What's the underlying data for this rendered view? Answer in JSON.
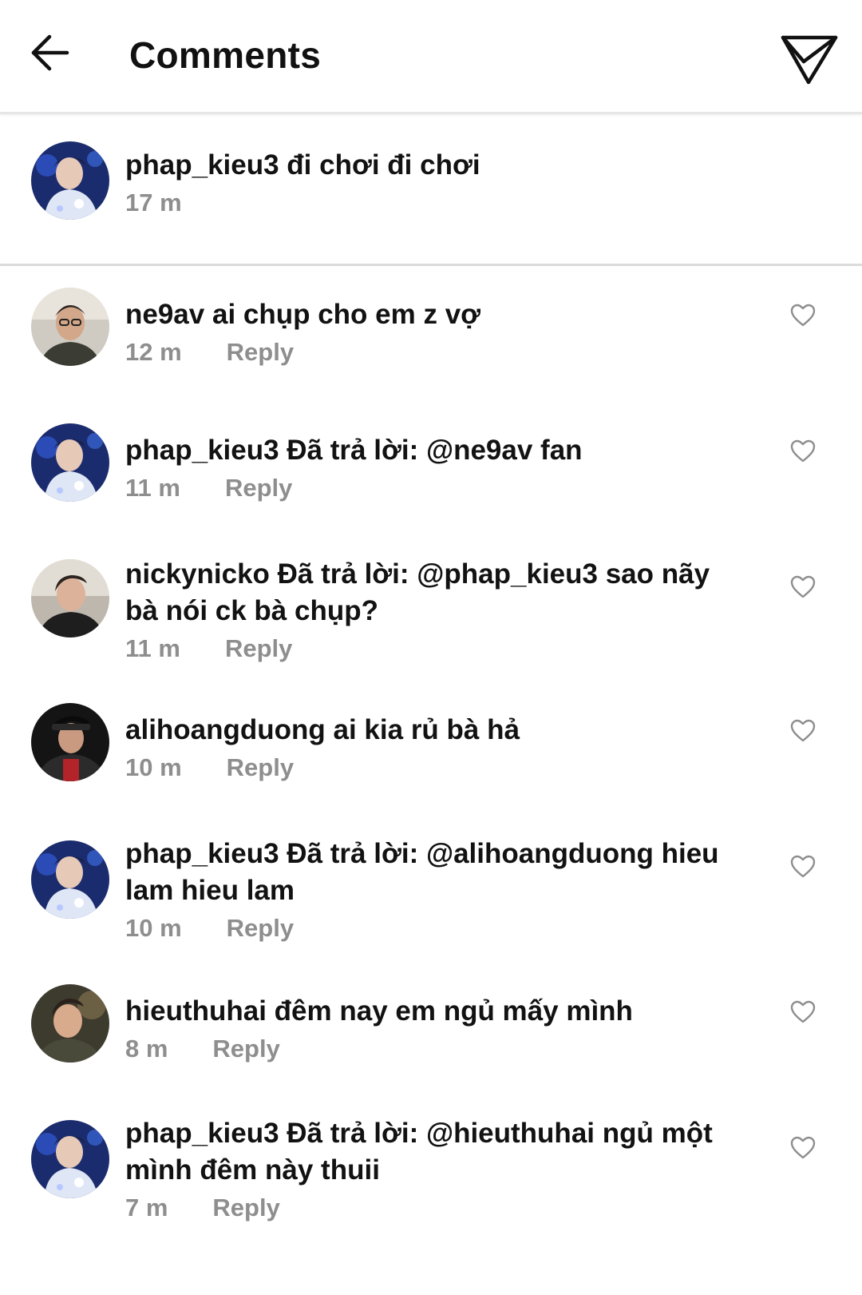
{
  "header": {
    "title": "Comments",
    "back_icon": "arrow-left-icon",
    "share_icon": "paper-plane-icon"
  },
  "caption": {
    "username": "phap_kieu3",
    "text": " đi chơi đi chơi",
    "time": "17 m"
  },
  "comments": [
    {
      "username": "ne9av",
      "text": " ai chụp cho em z vợ",
      "time": "12 m",
      "reply": "Reply",
      "avatar": "avatar-ne9av"
    },
    {
      "username": "phap_kieu3",
      "text": " Đã trả lời: @ne9av fan",
      "time": "11 m",
      "reply": "Reply",
      "avatar": "avatar-phap_kieu3"
    },
    {
      "username": "nickynicko",
      "text": " Đã trả lời: @phap_kieu3 sao nãy bà nói ck bà chụp?",
      "time": "11 m",
      "reply": "Reply",
      "avatar": "avatar-nickynicko"
    },
    {
      "username": "alihoangduong",
      "text": " ai kia rủ bà hả",
      "time": "10 m",
      "reply": "Reply",
      "avatar": "avatar-alihoangduong"
    },
    {
      "username": "phap_kieu3",
      "text": " Đã trả lời: @alihoangduong hieu lam hieu lam",
      "time": "10 m",
      "reply": "Reply",
      "avatar": "avatar-phap_kieu3"
    },
    {
      "username": "hieuthuhai",
      "text": " đêm nay em ngủ mấy mình",
      "time": "8 m",
      "reply": "Reply",
      "avatar": "avatar-hieuthuhai"
    },
    {
      "username": "phap_kieu3",
      "text": " Đã trả lời: @hieuthuhai ngủ một mình đêm này thuii",
      "time": "7 m",
      "reply": "Reply",
      "avatar": "avatar-phap_kieu3"
    }
  ],
  "colors": {
    "text": "#121212",
    "meta": "#8e8e8e",
    "divider": "#dbdbdb",
    "heart_outline": "#8e8e8e"
  },
  "like_icon": "heart-outline-icon"
}
